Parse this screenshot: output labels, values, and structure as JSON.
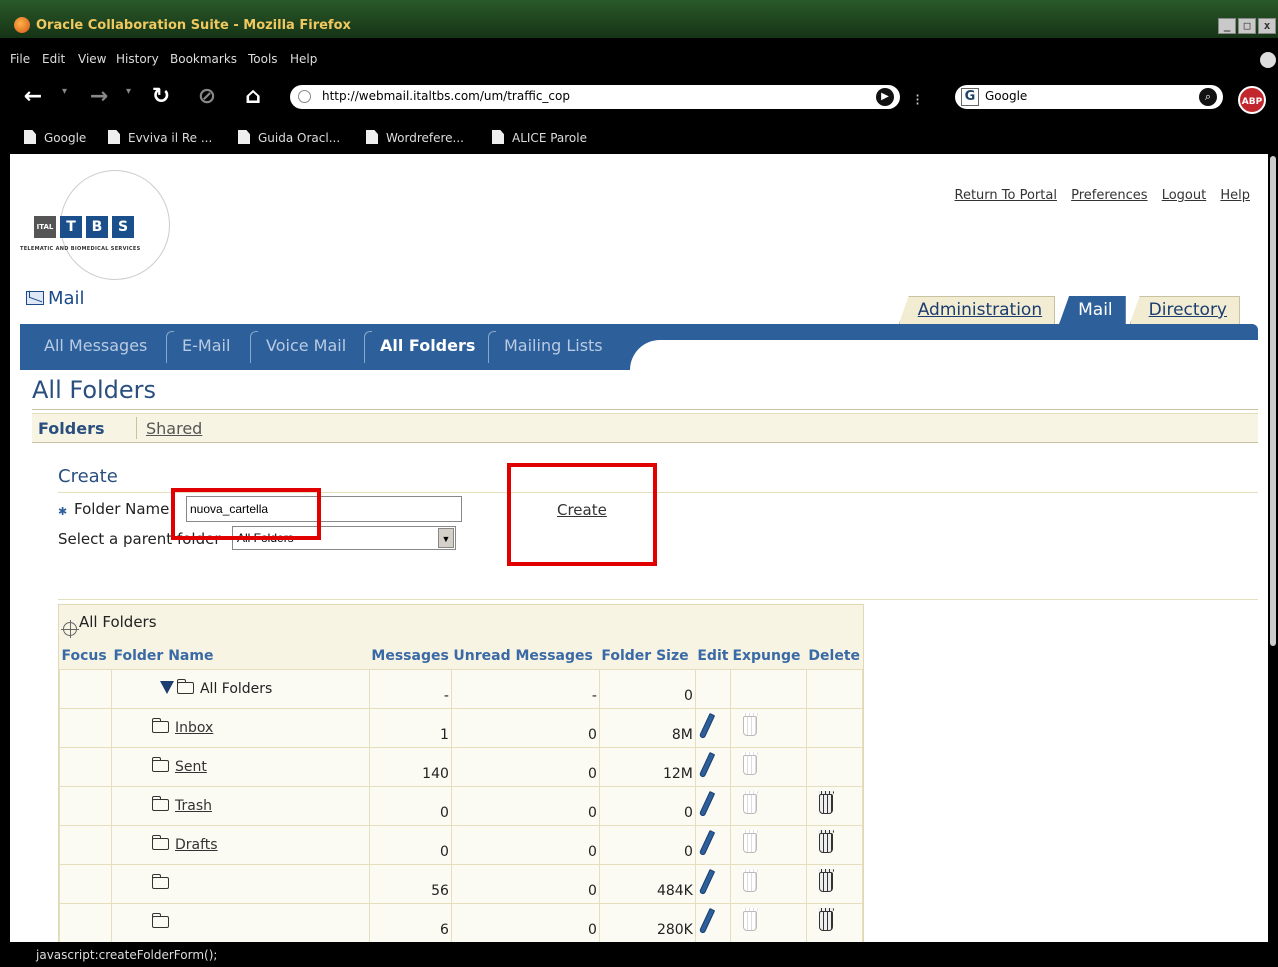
{
  "window": {
    "title": "Oracle Collaboration Suite - Mozilla Firefox"
  },
  "menu": [
    "File",
    "Edit",
    "View",
    "History",
    "Bookmarks",
    "Tools",
    "Help"
  ],
  "nav": {
    "url": "http://webmail.italtbs.com/um/traffic_cop",
    "search_value": "Google"
  },
  "bookmarks": [
    "Google",
    "Evviva il Re ...",
    "Guida Oracl...",
    "Wordrefere...",
    "ALICE Parole"
  ],
  "logo": {
    "letters": [
      "ITAL",
      "T",
      "B",
      "S"
    ],
    "tagline": "TELEMATIC AND BIOMEDICAL SERVICES"
  },
  "top_links": [
    "Return To Portal",
    "Preferences",
    "Logout",
    "Help"
  ],
  "app": {
    "name": "Mail"
  },
  "global_tabs": [
    "Administration",
    "Mail",
    "Directory"
  ],
  "sub_tabs": [
    "All Messages",
    "E-Mail",
    "Voice Mail",
    "All Folders",
    "Mailing Lists"
  ],
  "page": {
    "title": "All Folders"
  },
  "subnav": {
    "folders": "Folders",
    "shared": "Shared"
  },
  "create": {
    "heading": "Create",
    "folder_name_label": "Folder Name",
    "folder_name_value": "nuova_cartella",
    "parent_label": "Select a parent folder",
    "parent_value": "All Folders",
    "create_link": "Create"
  },
  "table": {
    "caption": "All Folders",
    "columns": [
      "Focus",
      "Folder Name",
      "Messages",
      "Unread Messages",
      "Folder Size",
      "Edit",
      "Expunge",
      "Delete"
    ],
    "rows": [
      {
        "name": "All Folders",
        "messages": "-",
        "unread": "-",
        "size": "0"
      },
      {
        "name": "Inbox",
        "messages": "1",
        "unread": "0",
        "size": "8M"
      },
      {
        "name": "Sent",
        "messages": "140",
        "unread": "0",
        "size": "12M"
      },
      {
        "name": "Trash",
        "messages": "0",
        "unread": "0",
        "size": "0"
      },
      {
        "name": "Drafts",
        "messages": "0",
        "unread": "0",
        "size": "0"
      },
      {
        "name": "",
        "messages": "56",
        "unread": "0",
        "size": "484K"
      },
      {
        "name": "",
        "messages": "6",
        "unread": "0",
        "size": "280K"
      }
    ]
  },
  "status": {
    "text": "javascript:createFolderForm();"
  },
  "colors": {
    "tab_blue": "#2d5f9a",
    "highlight_red": "#e00000",
    "panel_beige": "#f7f4e4"
  }
}
